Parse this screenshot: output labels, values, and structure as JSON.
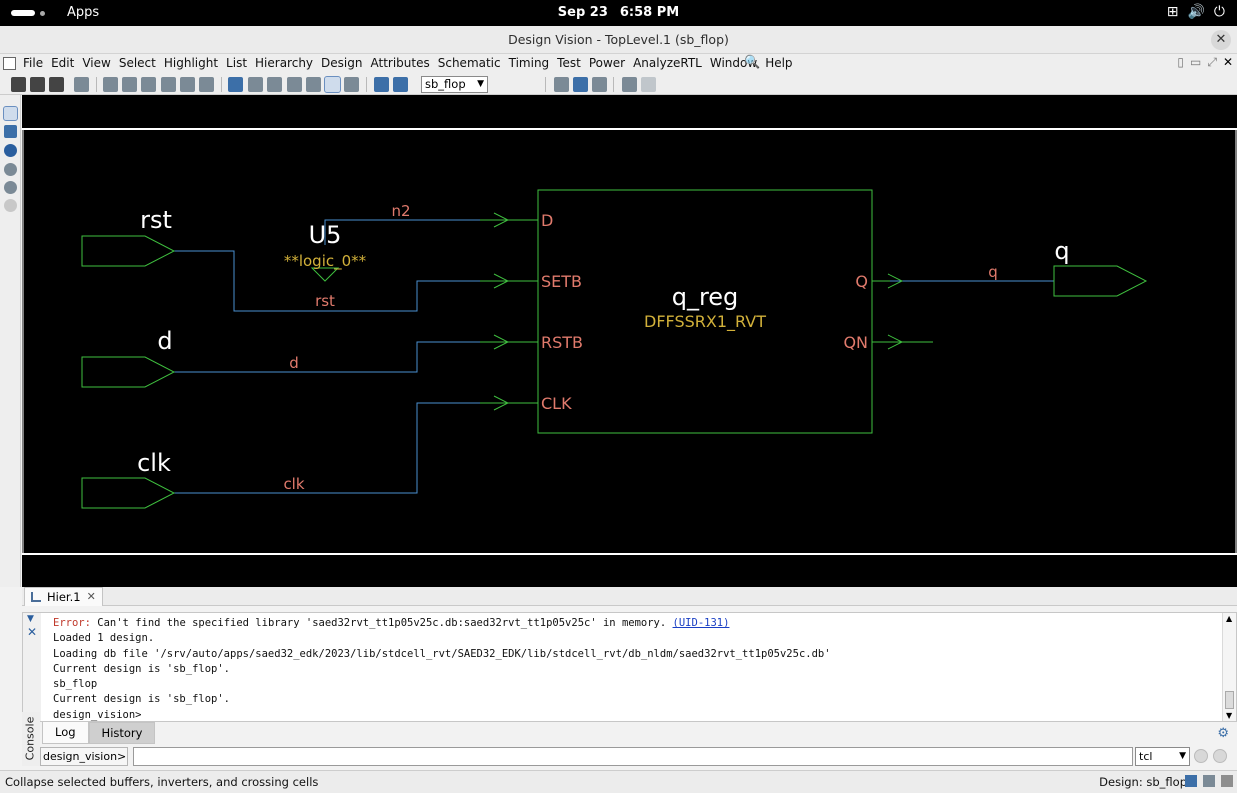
{
  "system_bar": {
    "activities_label": "Apps",
    "date": "Sep 23",
    "time": "6:58 PM"
  },
  "window": {
    "title": "Design Vision - TopLevel.1 (sb_flop)"
  },
  "menubar": {
    "items": [
      "File",
      "Edit",
      "View",
      "Select",
      "Highlight",
      "List",
      "Hierarchy",
      "Design",
      "Attributes",
      "Schematic",
      "Timing",
      "Test",
      "Power",
      "AnalyzeRTL",
      "Window",
      "Help"
    ]
  },
  "toolbar": {
    "design_select": "sb_flop"
  },
  "schematic": {
    "ports_in": [
      {
        "name": "rst"
      },
      {
        "name": "d"
      },
      {
        "name": "clk"
      }
    ],
    "port_out": {
      "name": "q"
    },
    "tie_cell": {
      "name": "U5",
      "type": "**logic_0**"
    },
    "register": {
      "name": "q_reg",
      "type": "DFFSSRX1_RVT",
      "pins_in": [
        "D",
        "SETB",
        "RSTB",
        "CLK"
      ],
      "pins_out": [
        "Q",
        "QN"
      ]
    },
    "nets": {
      "n2": "n2",
      "rst": "rst",
      "d": "d",
      "clk": "clk",
      "q": "q"
    },
    "colors": {
      "background": "#000000",
      "wire": "#4a8fd0",
      "cell_outline": "#3fbf3f",
      "pin_label": "#e07a6c",
      "cell_type": "#d2b13a",
      "port_label": "#ffffff"
    }
  },
  "tabs": {
    "hier_tab": "Hier.1"
  },
  "console": {
    "log": [
      {
        "prefix": "Error:",
        "text": " Can't find the specified library 'saed32rvt_tt1p05v25c.db:saed32rvt_tt1p05v25c' in memory. ",
        "link": "(UID-131)"
      },
      {
        "text": "Loaded 1 design."
      },
      {
        "text": "Loading db file '/srv/auto/apps/saed32_edk/2023/lib/stdcell_rvt/SAED32_EDK/lib/stdcell_rvt/db_nldm/saed32rvt_tt1p05v25c.db'"
      },
      {
        "text": "Current design is 'sb_flop'."
      },
      {
        "text": "sb_flop"
      },
      {
        "text": "Current design is 'sb_flop'."
      },
      {
        "text": "design_vision>"
      }
    ],
    "side_label": "Console",
    "tab_log": "Log",
    "tab_history": "History",
    "prompt": "design_vision>",
    "shell": "tcl"
  },
  "statusbar": {
    "message": "Collapse selected buffers, inverters, and crossing cells",
    "design": "Design: sb_flop"
  }
}
